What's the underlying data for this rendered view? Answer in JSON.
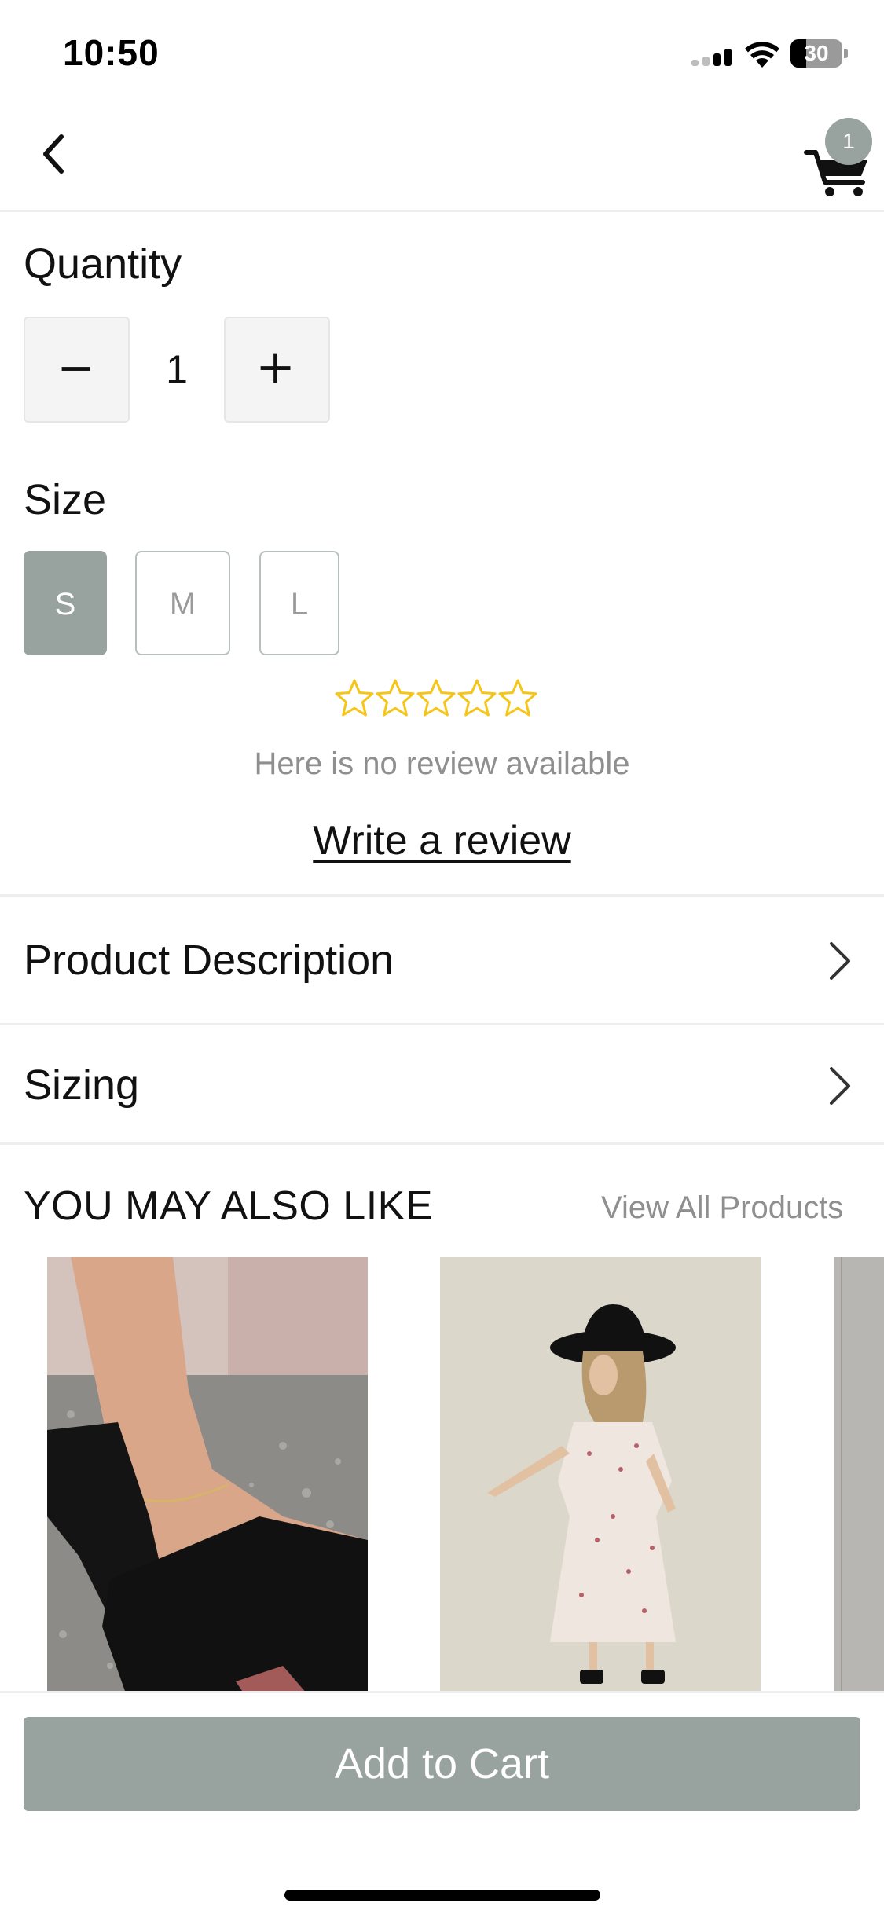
{
  "status_bar": {
    "time": "10:50",
    "battery": "30",
    "battery_level": 0.3
  },
  "header": {
    "cart_count": "1"
  },
  "quantity": {
    "label": "Quantity",
    "value": "1",
    "minus": "−",
    "plus": "+"
  },
  "size": {
    "label": "Size",
    "options": [
      "S",
      "M",
      "L"
    ],
    "selected": "S"
  },
  "rating": {
    "stars": 0,
    "max": 5,
    "star_color": "#F5C518"
  },
  "reviews": {
    "empty_text": "Here is no review available",
    "write_label": "Write a review"
  },
  "accordions": [
    {
      "label": "Product Description"
    },
    {
      "label": "Sizing"
    }
  ],
  "recommendations": {
    "title": "YOU MAY ALSO LIKE",
    "view_all": "View All Products"
  },
  "cta": {
    "add_to_cart": "Add to Cart"
  },
  "colors": {
    "accent": "#98A29E",
    "divider": "#EEEEEE",
    "muted_text": "#8F8F8F"
  }
}
